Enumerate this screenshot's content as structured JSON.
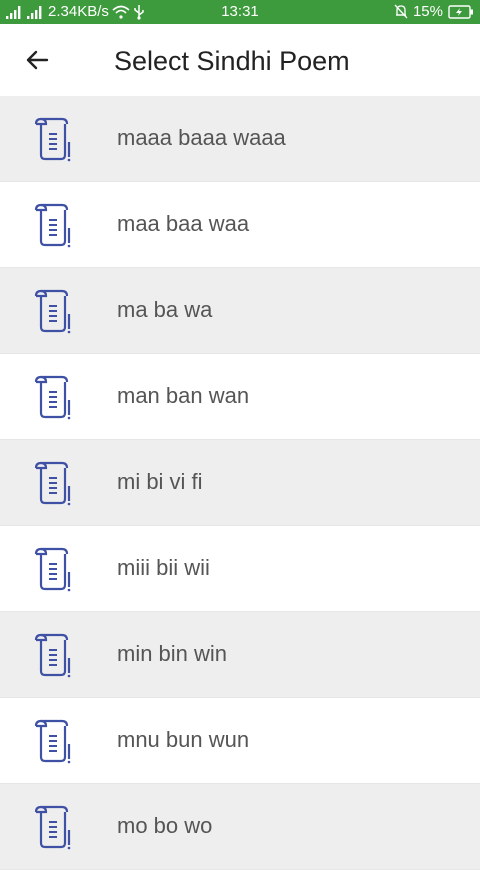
{
  "status_bar": {
    "network_speed": "2.34KB/s",
    "time": "13:31",
    "battery": "15%",
    "color": "#3d9a3d"
  },
  "app_bar": {
    "title": "Select Sindhi Poem",
    "back_icon": "arrow-left-icon"
  },
  "poems": [
    {
      "label": "maaa baaa waaa"
    },
    {
      "label": "maa baa waa"
    },
    {
      "label": "ma ba wa"
    },
    {
      "label": "man ban wan"
    },
    {
      "label": "mi bi vi fi"
    },
    {
      "label": "miii bii wii"
    },
    {
      "label": "min bin win"
    },
    {
      "label": "mnu bun wun"
    },
    {
      "label": "mo bo wo"
    }
  ],
  "poem_icon": "scroll-document-icon",
  "icon_color": "#3f51a5",
  "alt_row_color": "#eeeeee"
}
